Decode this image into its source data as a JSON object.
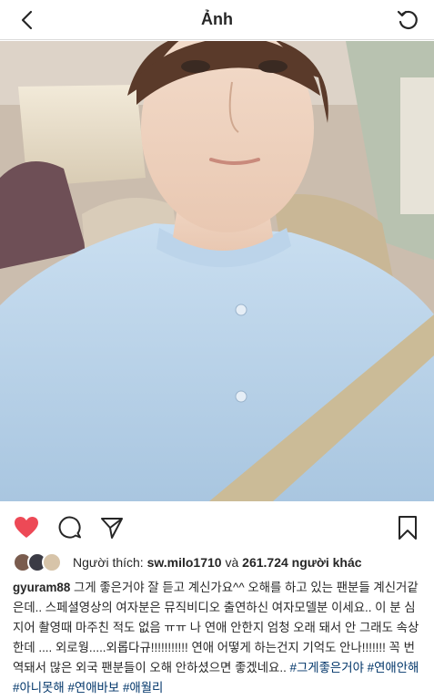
{
  "header": {
    "title": "Ảnh",
    "back_icon": "chevron-left-icon",
    "refresh_icon": "refresh-icon"
  },
  "photo": {
    "subject": "selfie-in-car"
  },
  "actions": {
    "like_icon": "heart-filled-icon",
    "comment_icon": "comment-icon",
    "share_icon": "send-icon",
    "save_icon": "bookmark-icon",
    "like_color": "#ed4956"
  },
  "likes": {
    "prefix": "Người thích:",
    "user": "sw.milo1710",
    "conj": "và",
    "count_text": "261.724 người khác"
  },
  "caption": {
    "username": "gyuram88",
    "text": "그게 좋은거야 잘 듣고 계신가요^^ 오해를 하고 있는 팬분들 계신거같은데.. 스페셜영상의 여자분은 뮤직비디오 출연하신 여자모델분 이세요.. 이 분 심지어 촬영때 마주친 적도 없음 ㅠㅠ 나 연애 안한지 엄청 오래 돼서 안 그래도 속상한데 .... 외로웡.....외롭다규!!!!!!!!!!! 연애 어떻게 하는건지 기억도 안나!!!!!!! 꼭 번역돼서 많은 외국 팬분들이 오해 안하셨으면 좋겠네요..",
    "hashtags": [
      "#그게좋은거야",
      "#연애안해",
      "#아니못해",
      "#연애바보",
      "#애월리"
    ]
  }
}
